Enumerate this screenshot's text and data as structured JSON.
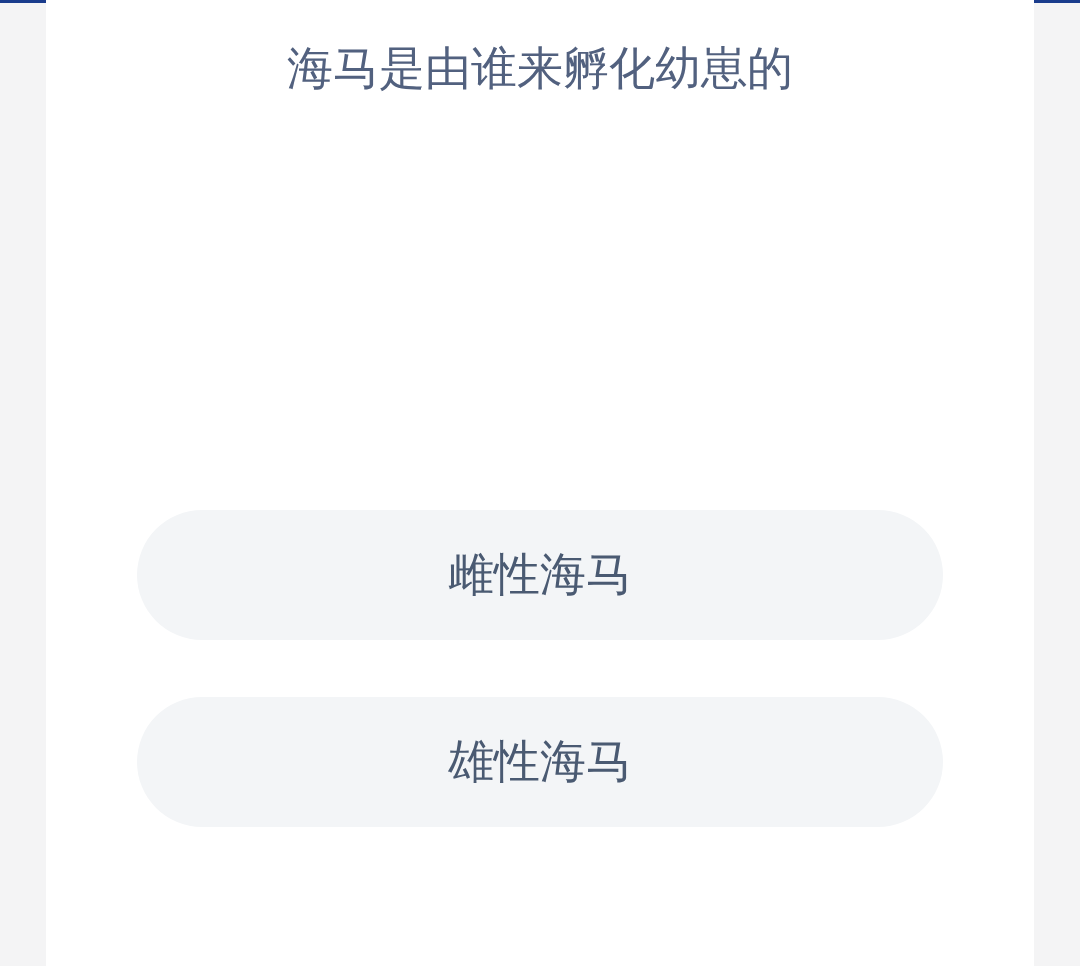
{
  "question": "海马是由谁来孵化幼崽的",
  "options": [
    {
      "label": "雌性海马"
    },
    {
      "label": "雄性海马"
    }
  ]
}
